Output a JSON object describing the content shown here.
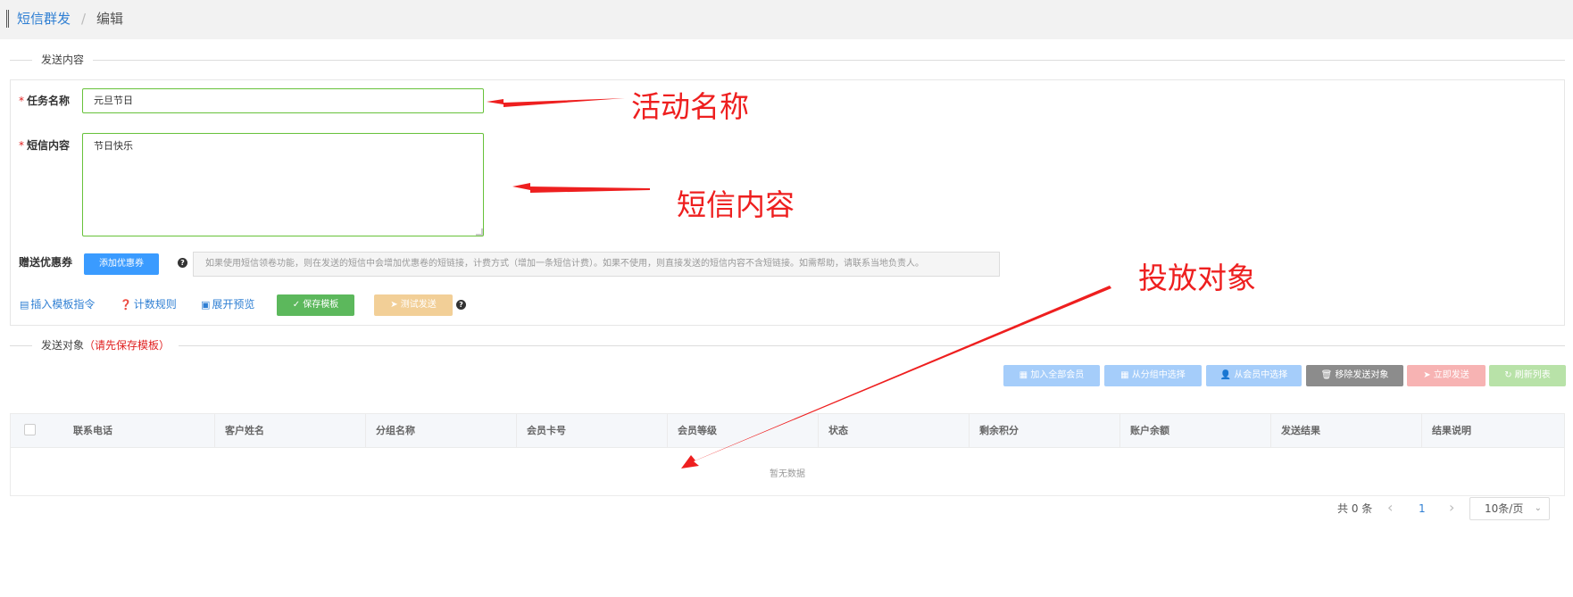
{
  "breadcrumb": {
    "parent": "短信群发",
    "separator": "/",
    "current": "编辑"
  },
  "section_content": {
    "title": "发送内容"
  },
  "form": {
    "task_name_label": "任务名称",
    "task_name_value": "元旦节日",
    "sms_content_label": "短信内容",
    "sms_content_value": "节日快乐",
    "required_mark": "*",
    "coupon_label": "赠送优惠券",
    "add_coupon_button": "添加优惠券",
    "help_mark": "?",
    "coupon_notice": "如果使用短信领卷功能，则在发送的短信中会增加优惠卷的短链接，计费方式（增加一条短信计费）。如果不使用，则直接发送的短信内容不含短链接。如需帮助，请联系当地负责人。"
  },
  "actions": {
    "insert_template": "插入模板指令",
    "count_rules": "计数规则",
    "expand_preview": "展开预览",
    "save_template": "保存模板",
    "test_send": "测试发送"
  },
  "section_target": {
    "title": "发送对象",
    "warning": "（请先保存模板）"
  },
  "toolbar": {
    "add_all_members": "加入全部会员",
    "select_from_group": "从分组中选择",
    "select_from_members": "从会员中选择",
    "remove_targets": "移除发送对象",
    "send_now": "立即发送",
    "refresh_list": "刷新列表"
  },
  "table": {
    "columns": [
      "联系电话",
      "客户姓名",
      "分组名称",
      "会员卡号",
      "会员等级",
      "状态",
      "剩余积分",
      "账户余额",
      "发送结果",
      "结果说明"
    ],
    "empty_text": "暂无数据"
  },
  "pagination": {
    "total": "共 0 条",
    "current_page": "1",
    "page_size": "10条/页",
    "prev": "‹",
    "next": "›"
  },
  "annotations": {
    "activity_name": "活动名称",
    "sms_content": "短信内容",
    "target": "投放对象"
  },
  "colors": {
    "primary": "#3a9bff",
    "success": "#5cb85c",
    "annotation": "#ee1f1f",
    "link": "#2f7fd3"
  }
}
